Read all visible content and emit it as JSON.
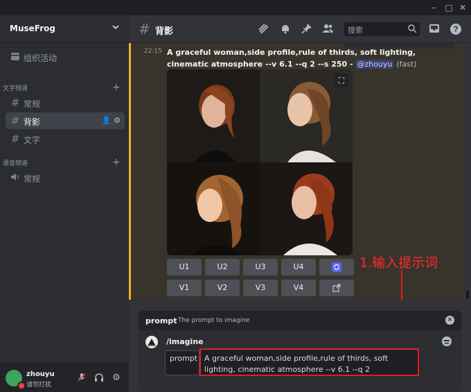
{
  "window": {
    "minimize": "–",
    "maximize": "□",
    "close": "✕"
  },
  "sidebar": {
    "server_name": "MuseFrog",
    "events_label": "组织活动",
    "categories": [
      {
        "name": "文字频道",
        "channels": [
          "常规",
          "背影",
          "文字"
        ]
      },
      {
        "name": "语音频道",
        "channels": [
          "常规"
        ]
      }
    ],
    "active_channel": "背影"
  },
  "user": {
    "name": "zhouyu",
    "status": "请勿打扰"
  },
  "header": {
    "channel_name": "背影",
    "search_placeholder": "搜索"
  },
  "message": {
    "time": "22:15",
    "text": "A graceful woman,side profile,rule of thirds, soft lighting, cinematic atmosphere --v 6.1 --q 2 --s 250 -",
    "mention": "@zhouyu",
    "suffix": "(fast)",
    "buttons_row1": [
      "U1",
      "U2",
      "U3",
      "U4"
    ],
    "buttons_row2": [
      "V1",
      "V2",
      "V3",
      "V4"
    ],
    "reroll_icon": "refresh-icon",
    "open_icon": "external-link-icon"
  },
  "annotation": "1.输入提示词",
  "autocomplete": {
    "param_name": "prompt",
    "param_desc": "The prompt to imagine",
    "command": "/imagine"
  },
  "composer": {
    "param_label": "prompt",
    "value": "A graceful woman,side profile,rule of thirds, soft lighting, cinematic atmosphere --v 6.1 --q 2"
  },
  "colors": {
    "accent": "#5865f2",
    "mention_bar": "#f0b132",
    "annotation_red": "#e11f1f"
  }
}
